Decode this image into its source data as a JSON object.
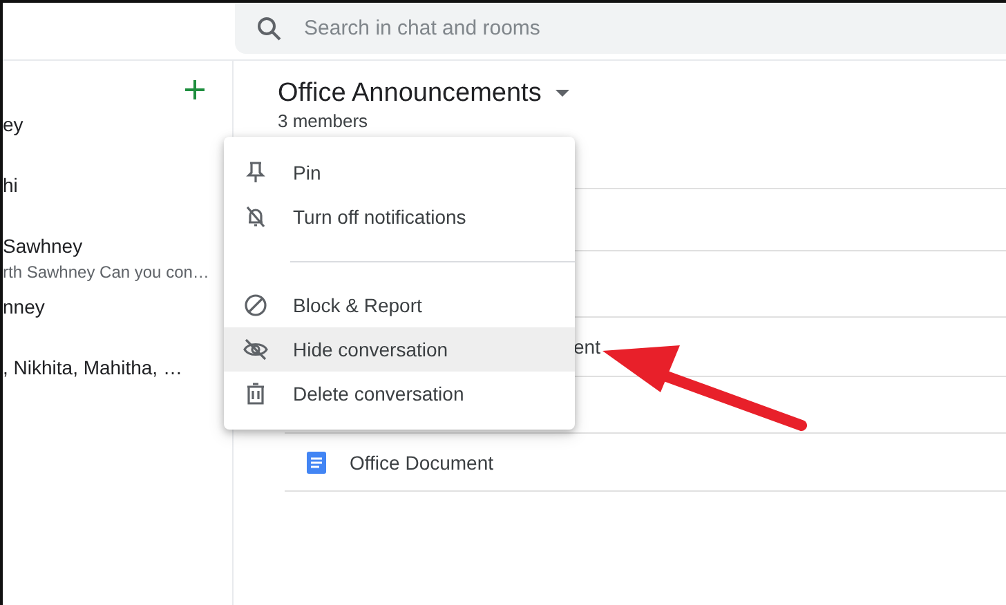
{
  "search": {
    "placeholder": "Search in chat and rooms"
  },
  "sidebar": {
    "items": [
      {
        "name": "ey"
      },
      {
        "name": "hi"
      },
      {
        "name": "Sawhney",
        "preview": "rth Sawhney Can you con…"
      },
      {
        "name": "nney"
      },
      {
        "name": ", Nikhita, Mahitha, …"
      }
    ]
  },
  "room": {
    "title": "Office Announcements",
    "subtitle": "3 members",
    "rows": [
      {
        "kind": "text",
        "text": "ent"
      },
      {
        "kind": "document",
        "text": "Office Document"
      }
    ]
  },
  "menu": {
    "items": [
      {
        "kind": "pin",
        "label": "Pin",
        "selected": false
      },
      {
        "kind": "bell-off",
        "label": "Turn off notifications",
        "selected": false
      },
      {
        "kind": "divider"
      },
      {
        "kind": "block",
        "label": "Block & Report",
        "selected": false
      },
      {
        "kind": "hide",
        "label": "Hide conversation",
        "selected": true
      },
      {
        "kind": "trash",
        "label": "Delete conversation",
        "selected": false
      }
    ]
  }
}
